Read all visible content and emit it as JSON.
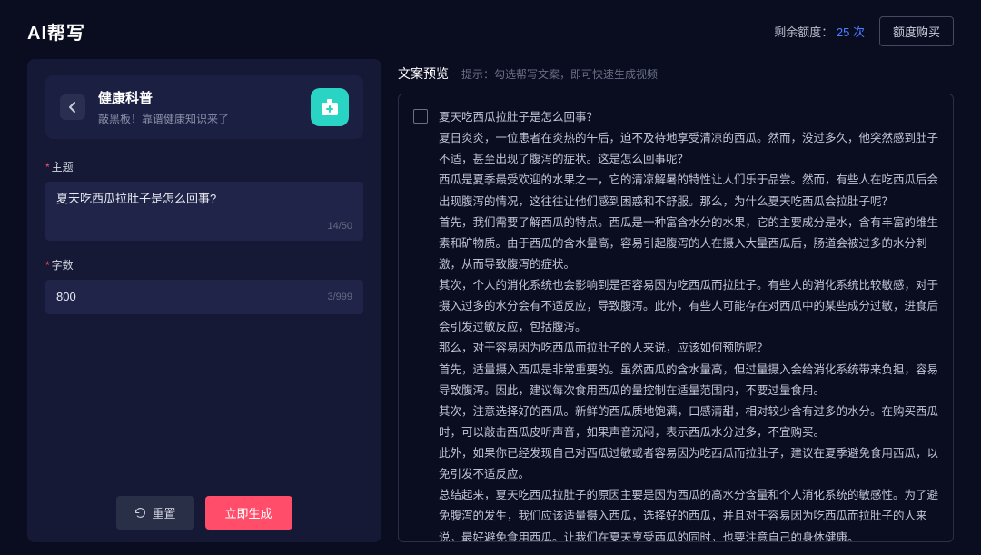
{
  "header": {
    "title": "AI帮写",
    "quota_label": "剩余额度：",
    "quota_count": "25 次",
    "buy_label": "额度购买"
  },
  "category": {
    "title": "健康科普",
    "subtitle": "敲黑板！靠谱健康知识来了"
  },
  "form": {
    "topic_label": "主题",
    "topic_value": "夏天吃西瓜拉肚子是怎么回事?",
    "topic_counter": "14/50",
    "count_label": "字数",
    "count_value": "800",
    "count_counter": "3/999"
  },
  "actions": {
    "reset": "重置",
    "generate": "立即生成"
  },
  "preview": {
    "title": "文案预览",
    "hint": "提示：勾选帮写文案，即可快速生成视频",
    "content": "夏天吃西瓜拉肚子是怎么回事？\n夏日炎炎，一位患者在炎热的午后，迫不及待地享受清凉的西瓜。然而，没过多久，他突然感到肚子不适，甚至出现了腹泻的症状。这是怎么回事呢？\n西瓜是夏季最受欢迎的水果之一，它的清凉解暑的特性让人们乐于品尝。然而，有些人在吃西瓜后会出现腹泻的情况，这往往让他们感到困惑和不舒服。那么，为什么夏天吃西瓜会拉肚子呢？\n首先，我们需要了解西瓜的特点。西瓜是一种富含水分的水果，它的主要成分是水，含有丰富的维生素和矿物质。由于西瓜的含水量高，容易引起腹泻的人在摄入大量西瓜后，肠道会被过多的水分刺激，从而导致腹泻的症状。\n其次，个人的消化系统也会影响到是否容易因为吃西瓜而拉肚子。有些人的消化系统比较敏感，对于摄入过多的水分会有不适反应，导致腹泻。此外，有些人可能存在对西瓜中的某些成分过敏，进食后会引发过敏反应，包括腹泻。\n那么，对于容易因为吃西瓜而拉肚子的人来说，应该如何预防呢？\n首先，适量摄入西瓜是非常重要的。虽然西瓜的含水量高，但过量摄入会给消化系统带来负担，容易导致腹泻。因此，建议每次食用西瓜的量控制在适量范围内，不要过量食用。\n其次，注意选择好的西瓜。新鲜的西瓜质地饱满，口感清甜，相对较少含有过多的水分。在购买西瓜时，可以敲击西瓜皮听声音，如果声音沉闷，表示西瓜水分过多，不宜购买。\n此外，如果你已经发现自己对西瓜过敏或者容易因为吃西瓜而拉肚子，建议在夏季避免食用西瓜，以免引发不适反应。\n总结起来，夏天吃西瓜拉肚子的原因主要是因为西瓜的高水分含量和个人消化系统的敏感性。为了避免腹泻的发生，我们应该适量摄入西瓜，选择好的西瓜，并且对于容易因为吃西瓜而拉肚子的人来说，最好避免食用西瓜。让我们在夏天享受西瓜的同时，也要注意自己的身体健康。"
  }
}
